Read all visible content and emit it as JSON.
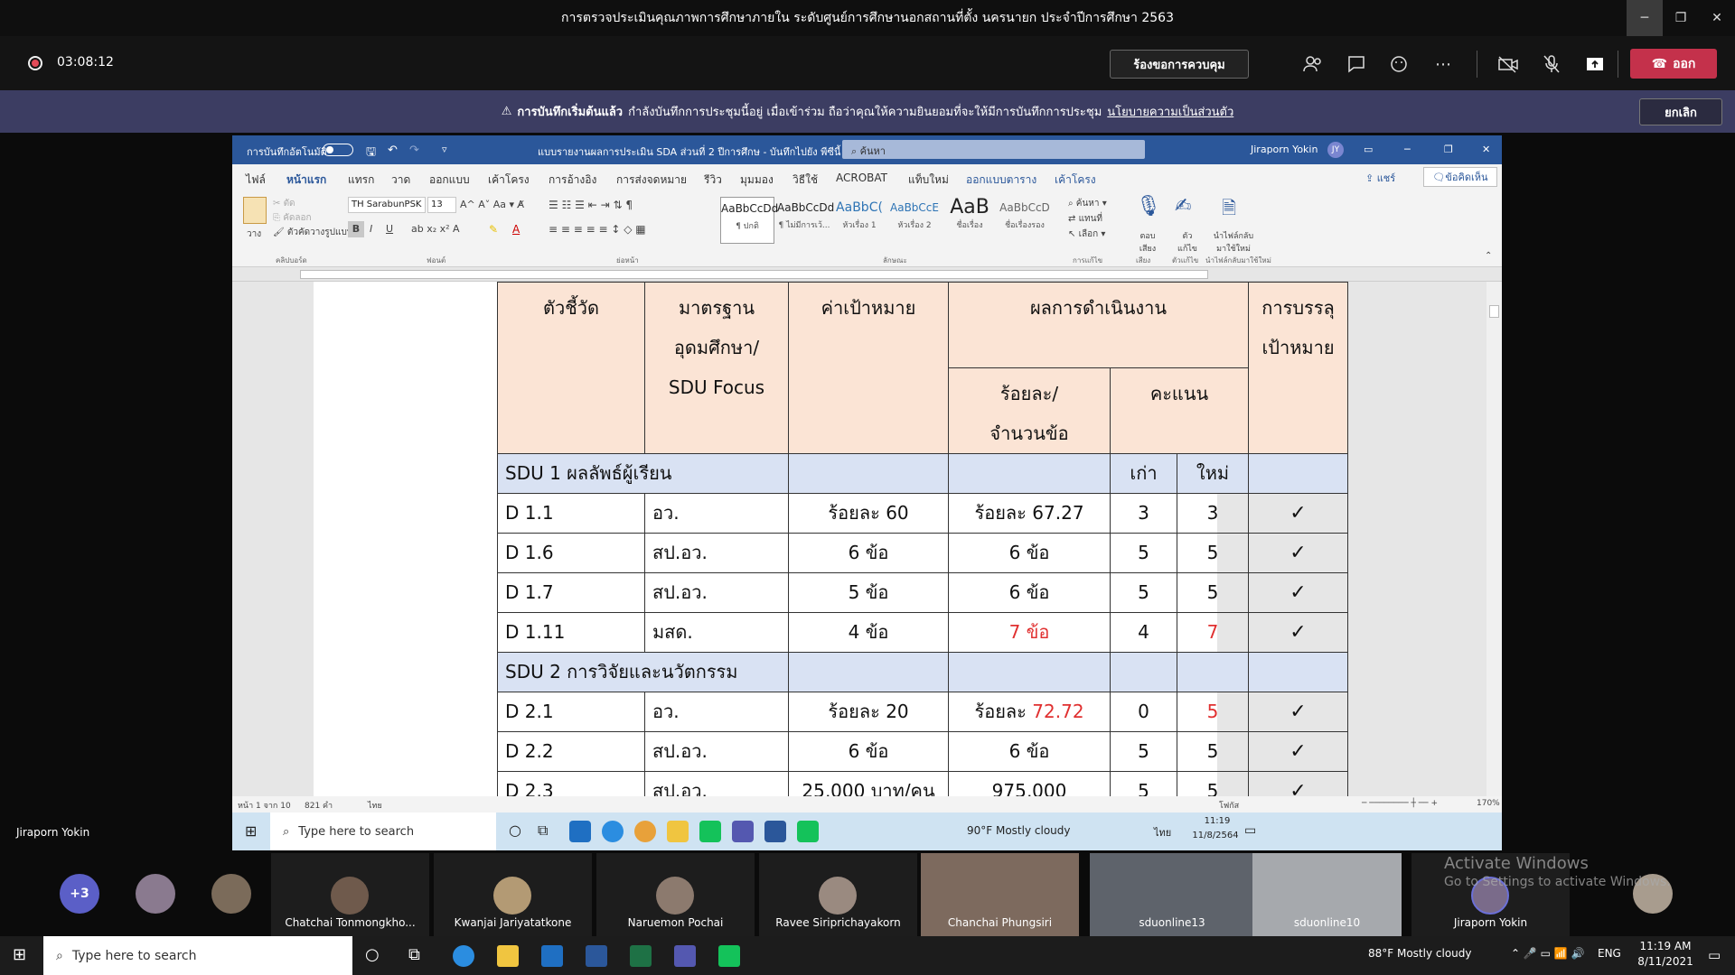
{
  "window": {
    "title": "การตรวจประเมินคุณภาพการศึกษาภายใน ระดับศูนย์การศึกษานอกสถานที่ตั้ง นครนายก ประจำปีการศึกษา 2563",
    "minimize": "─",
    "maximize": "❐",
    "close": "✕"
  },
  "meeting": {
    "timer": "03:08:12",
    "request_control": "ร้องขอการควบคุม",
    "leave": "ออก",
    "icons": [
      "people-icon",
      "chat-icon",
      "reactions-icon",
      "more-icon",
      "camera-off-icon",
      "mic-off-icon",
      "share-tray-icon"
    ]
  },
  "banner": {
    "bold": "การบันทึกเริ่มต้นแล้ว",
    "text": "กำลังบันทึกการประชุมนี้อยู่ เมื่อเข้าร่วม ถือว่าคุณให้ความยินยอมที่จะให้มีการบันทึกการประชุม",
    "link": "นโยบายความเป็นส่วนตัว",
    "cancel": "ยกเลิก"
  },
  "word": {
    "autosave": "การบันทึกอัตโนมัติ",
    "doc_title": "แบบรายงานผลการประเมิน SDA ส่วนที่ 2 ปีการศึกษ  -  บันทึกไปยัง พีซีนี้ ▾",
    "search": "ค้นหา",
    "user": "Jiraporn Yokin",
    "user_initials": "JY",
    "tabs": [
      "ไฟล์",
      "หน้าแรก",
      "แทรก",
      "วาด",
      "ออกแบบ",
      "เค้าโครง",
      "การอ้างอิง",
      "การส่งจดหมาย",
      "รีวิว",
      "มุมมอง",
      "วิธีใช้",
      "ACROBAT",
      "แท็บใหม่",
      "ออกแบบตาราง",
      "เค้าโครง"
    ],
    "share": "แชร์",
    "comment": "ข้อคิดเห็น",
    "ribbon": {
      "paste": "วาง",
      "cut": "ตัด",
      "copy": "คัดลอก",
      "format_painter": "ตัวคัดวางรูปแบบ",
      "font": "TH SarabunPSK",
      "size": "13",
      "styles": [
        {
          "sample": "AaBbCcDd",
          "name": "¶ ปกติ"
        },
        {
          "sample": "AaBbCcDd",
          "name": "¶ ไม่มีการเว้..."
        },
        {
          "sample": "AaBbC(",
          "name": "หัวเรื่อง 1"
        },
        {
          "sample": "AaBbCcE",
          "name": "หัวเรื่อง 2"
        },
        {
          "sample": "AaB",
          "name": "ชื่อเรื่อง"
        },
        {
          "sample": "AaBbCcD",
          "name": "ชื่อเรื่องรอง"
        }
      ],
      "find": "ค้นหา",
      "replace": "แทนที่",
      "select": "เลือก",
      "dictate": "ตอบ เสียง",
      "editor": "ตัว แก้ไข",
      "reuse": "นำไฟล์กลับ มาใช้ใหม่",
      "groups": [
        "คลิปบอร์ด",
        "ฟอนต์",
        "ย่อหน้า",
        "ลักษณะ",
        "การแก้ไข",
        "เสียง",
        "ตัวแก้ไข",
        "นำไฟล์กลับมาใช้ใหม่"
      ]
    },
    "status": {
      "page": "หน้า 1 จาก 10",
      "words": "821 คำ",
      "lang": "ไทย",
      "focus": "โฟกัส",
      "zoom": "170%"
    }
  },
  "table": {
    "h_indicator": "ตัวชี้วัด",
    "h_standard": [
      "มาตรฐาน",
      "อุดมศึกษา/",
      "SDU Focus"
    ],
    "h_target": "ค่าเป้าหมาย",
    "h_result": "ผลการดำเนินงาน",
    "h_achieve": [
      "การบรรลุ",
      "เป้าหมาย"
    ],
    "h_percent": [
      "ร้อยละ/",
      "จำนวนข้อ"
    ],
    "h_score": "คะแนน",
    "old": "เก่า",
    "new": "ใหม่",
    "sec1": "SDU 1 ผลลัพธ์ผู้เรียน",
    "sec2": "SDU 2 การวิจัยและนวัตกรรม",
    "rows": [
      {
        "ind": "D 1.1",
        "std": "อว.",
        "target": "ร้อยละ 60",
        "result_pre": "",
        "result": "ร้อยละ 67.27",
        "old": "3",
        "new": "3",
        "mark": "✓"
      },
      {
        "ind": "D 1.6",
        "std": "สป.อว.",
        "target": "6 ข้อ",
        "result_pre": "",
        "result": "6 ข้อ",
        "old": "5",
        "new": "5",
        "mark": "✓"
      },
      {
        "ind": "D 1.7",
        "std": "สป.อว.",
        "target": "5 ข้อ",
        "result_pre": "",
        "result": "6 ข้อ",
        "old": "5",
        "new": "5",
        "mark": "✓"
      },
      {
        "ind": "D 1.11",
        "std": "มสด.",
        "target": "4 ข้อ",
        "result_pre": "",
        "result": "7 ข้อ",
        "old": "4",
        "new": "7",
        "mark": "✓"
      },
      {
        "ind": "D 2.1",
        "std": "อว.",
        "target": "ร้อยละ 20",
        "result_pre": "ร้อยละ ",
        "result": "72.72",
        "old": "0",
        "new": "5",
        "mark": "✓"
      },
      {
        "ind": "D 2.2",
        "std": "สป.อว.",
        "target": "6 ข้อ",
        "result_pre": "",
        "result": "6 ข้อ",
        "old": "5",
        "new": "5",
        "mark": "✓"
      },
      {
        "ind": "D 2.3",
        "std": "สป.อว.",
        "target": "25,000 บาท/คน",
        "result_pre": "",
        "result": "975,000",
        "old": "5",
        "new": "5",
        "mark": "✓"
      }
    ]
  },
  "remote_taskbar": {
    "search": "Type here to search",
    "weather": "90°F  Mostly cloudy",
    "lang": "ไทย",
    "time": "11:19",
    "date": "11/8/2564"
  },
  "presenter": "Jiraporn Yokin",
  "gallery": {
    "overflow": "+3",
    "participants": [
      "Chatchai Tonmongkho...",
      "Kwanjai Jariyatatkone",
      "Naruemon Pochai",
      "Ravee Siriprichayakorn",
      "Chanchai Phungsiri",
      "sduonline13",
      "sduonline10",
      "Jiraporn Yokin"
    ]
  },
  "activate": {
    "line1": "Activate Windows",
    "line2": "Go to Settings to activate Windows."
  },
  "taskbar": {
    "search": "Type here to search",
    "weather": "88°F  Mostly cloudy",
    "lang": "ENG",
    "time": "11:19 AM",
    "date": "8/11/2021"
  },
  "colors": {
    "word_blue": "#2b579a",
    "teams_leave": "#c4314b",
    "banner_bg": "#3c3d62",
    "header_peach": "#fbe4d5",
    "section_blue": "#d9e2f3",
    "red_text": "#e03030"
  }
}
